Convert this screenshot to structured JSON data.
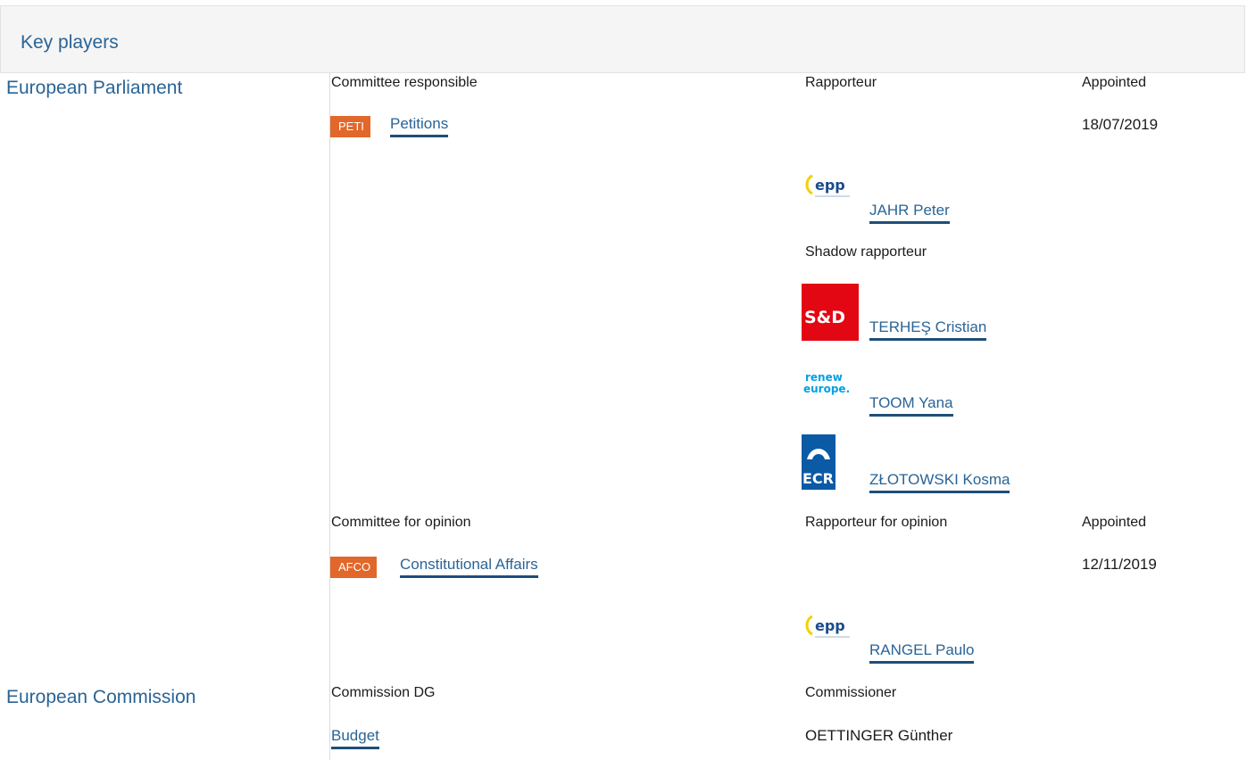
{
  "header": {
    "title": "Key players"
  },
  "parliament": {
    "title": "European Parliament",
    "col_committee_responsible": "Committee responsible",
    "col_rapporteur": "Rapporteur",
    "col_appointed": "Appointed",
    "committee": {
      "code": "PETI",
      "name": "Petitions",
      "appointed": "18/07/2019"
    },
    "rapporteur": {
      "group": "epp",
      "name": "JAHR Peter"
    },
    "shadow_label": "Shadow rapporteur",
    "shadows": [
      {
        "group": "S&D",
        "name": "TERHEŞ Cristian"
      },
      {
        "group": "renew europe.",
        "name": "TOOM Yana"
      },
      {
        "group": "ECR",
        "name": "ZŁOTOWSKI Kosma"
      }
    ],
    "col_committee_opinion": "Committee for opinion",
    "col_rapporteur_opinion": "Rapporteur for opinion",
    "col_appointed_opinion": "Appointed",
    "opinion_committee": {
      "code": "AFCO",
      "name": "Constitutional Affairs",
      "appointed": "12/11/2019"
    },
    "opinion_rapporteur": {
      "group": "epp",
      "name": "RANGEL Paulo"
    }
  },
  "commission": {
    "title": "European Commission",
    "col_dg": "Commission DG",
    "col_commissioner": "Commissioner",
    "dg": "Budget",
    "commissioner": "OETTINGER Günther"
  },
  "colors": {
    "link": "#2a6496",
    "badge": "#e1672b",
    "sd_red": "#e30613",
    "ecr_blue": "#0b5aa5"
  }
}
